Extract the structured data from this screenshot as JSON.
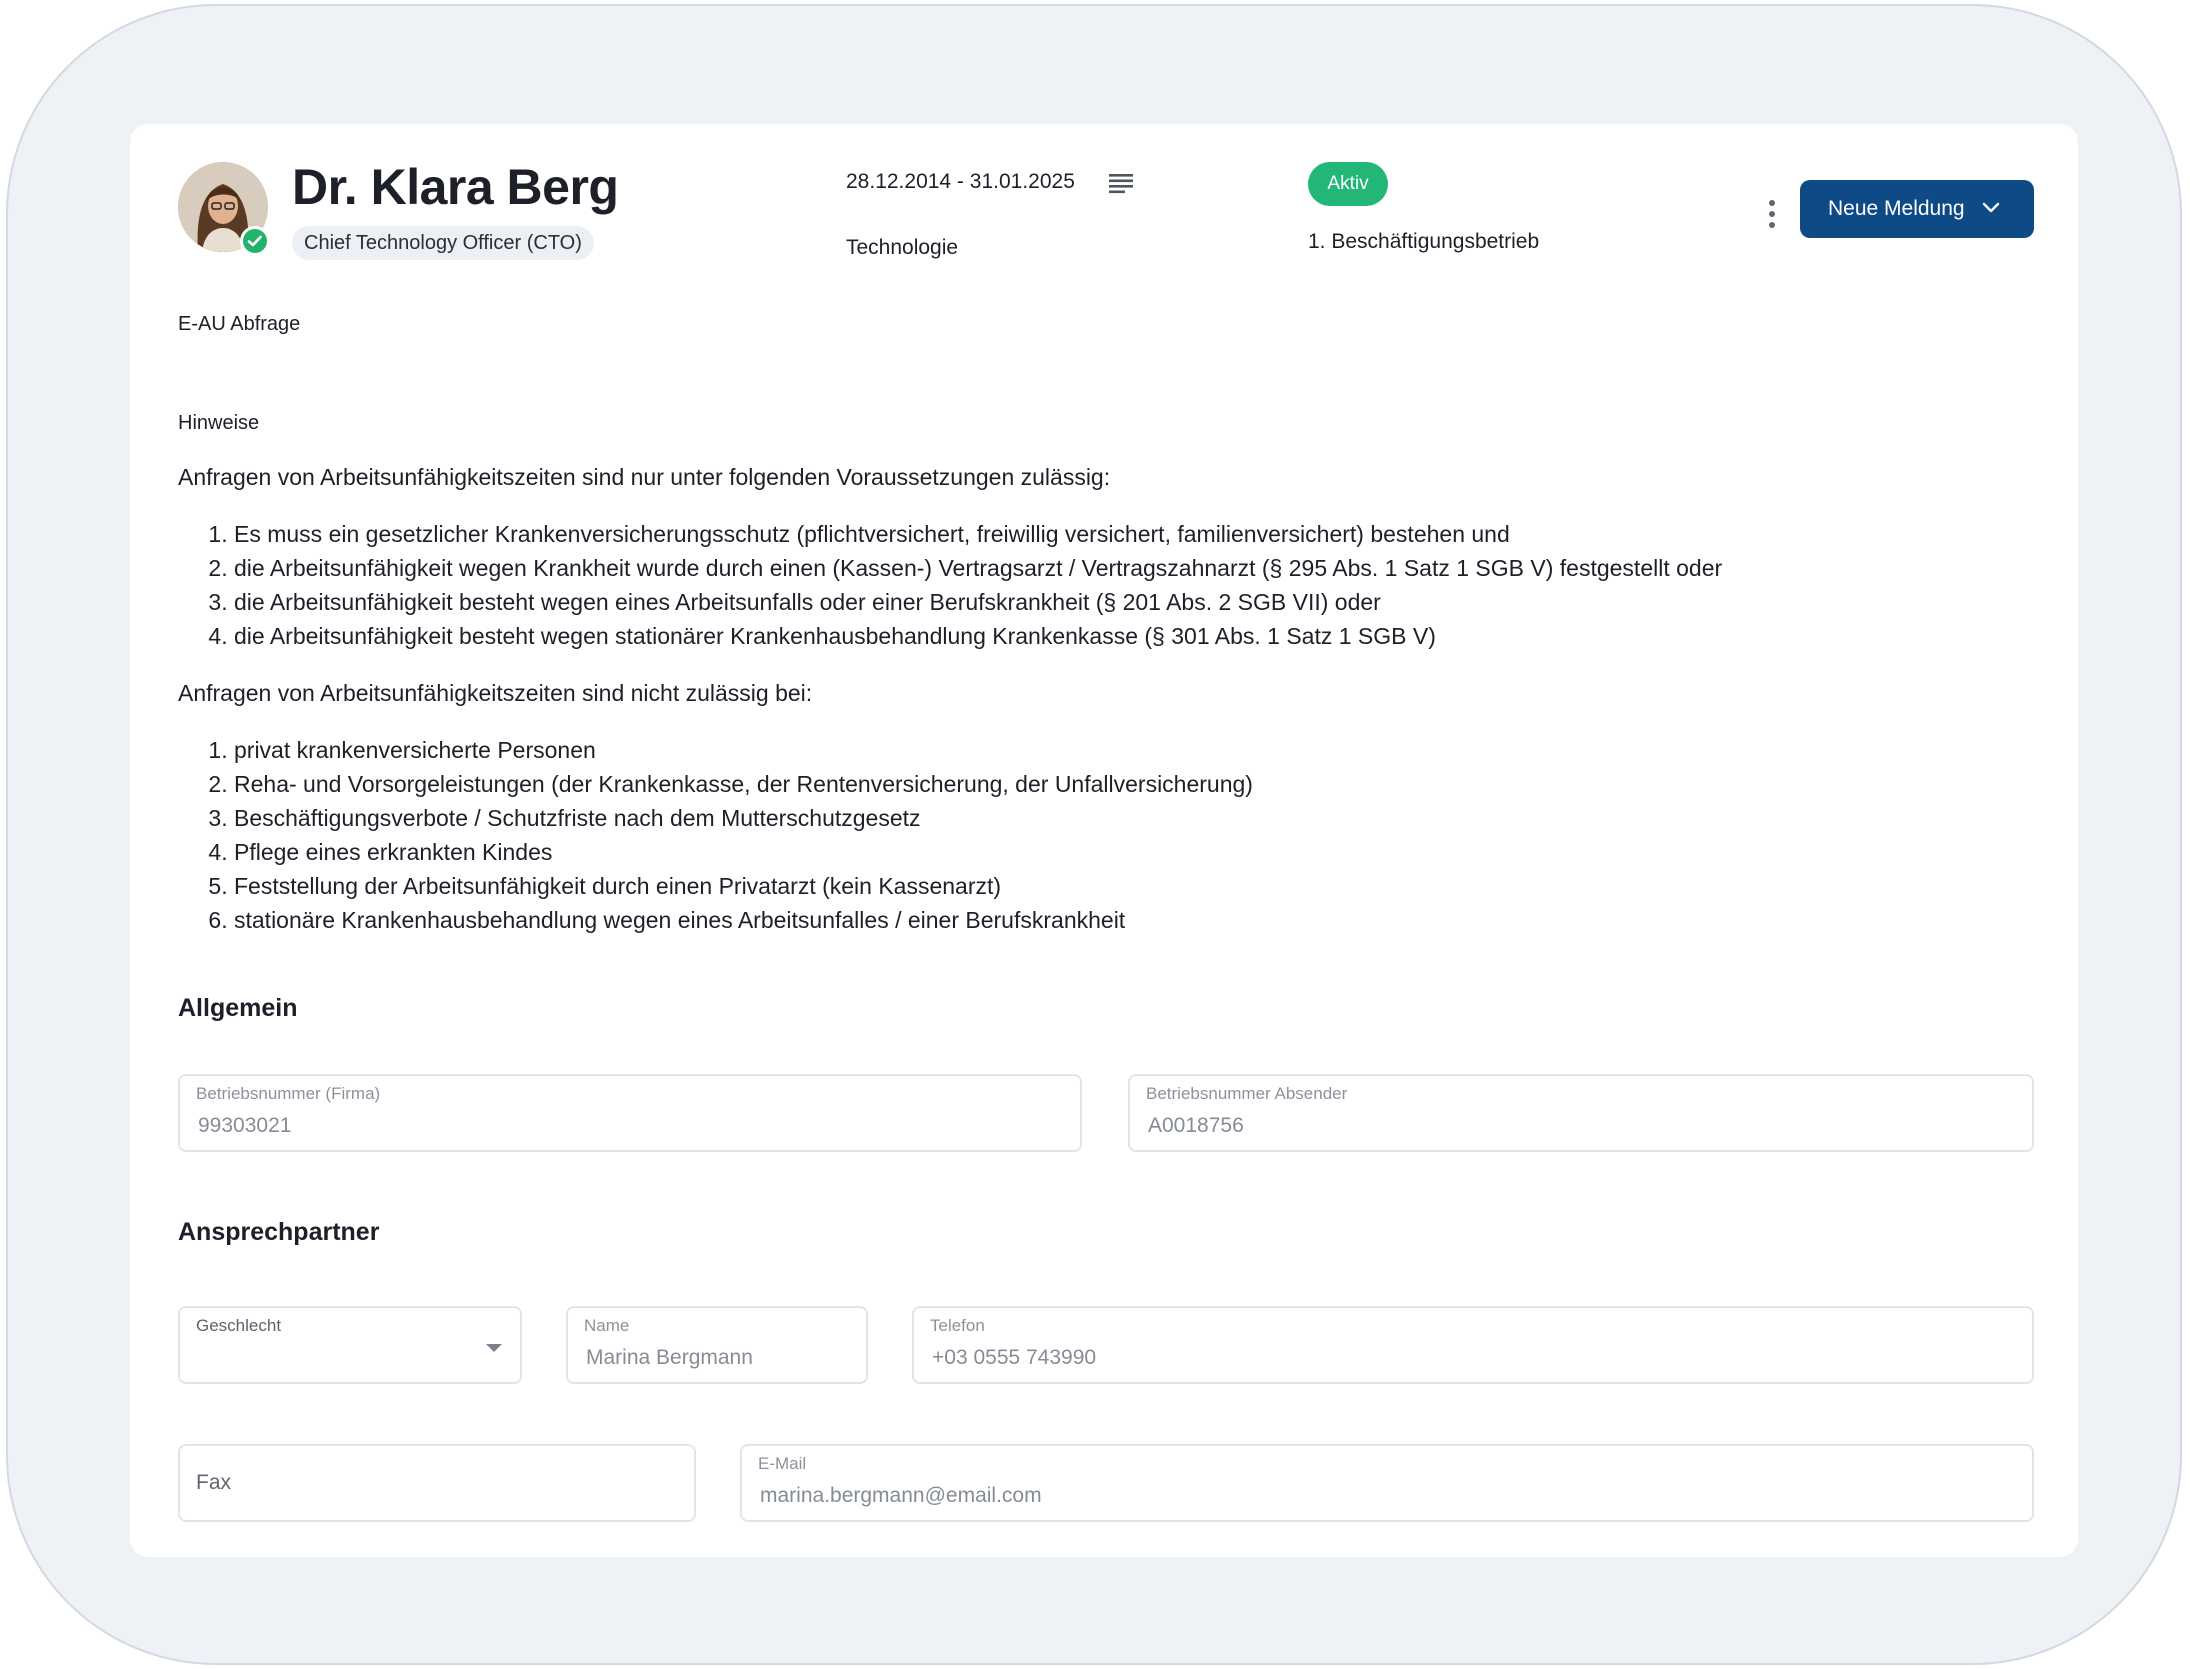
{
  "header": {
    "name": "Dr. Klara Berg",
    "role": "Chief Technology Officer (CTO)",
    "period": "28.12.2014 - 31.01.2025",
    "department": "Technologie",
    "status": "Aktiv",
    "employment": "1. Beschäftigungsbetrieb",
    "primary_button": "Neue Meldung",
    "colors": {
      "primary": "#0d4a86",
      "status": "#22b776",
      "verified": "#23b46c"
    }
  },
  "page_title": "E-AU Abfrage",
  "notes": {
    "title": "Hinweise",
    "allowed_intro": "Anfragen von Arbeitsunfähigkeitszeiten sind nur unter folgenden Voraussetzungen zulässig:",
    "allowed": [
      "Es muss ein gesetzlicher Krankenversicherungsschutz (pflichtversichert, freiwillig versichert, familienversichert) bestehen und",
      "die Arbeitsunfähigkeit wegen Krankheit wurde durch einen (Kassen-) Vertragsarzt / Vertragszahnarzt (§ 295 Abs. 1 Satz 1 SGB V) festgestellt oder",
      "die Arbeitsunfähigkeit besteht wegen eines Arbeitsunfalls oder einer Berufskrankheit (§ 201 Abs. 2 SGB VII) oder",
      "die Arbeitsunfähigkeit besteht wegen stationärer Krankenhausbehandlung Krankenkasse (§ 301 Abs. 1 Satz 1 SGB V)"
    ],
    "not_allowed_intro": "Anfragen von Arbeitsunfähigkeitszeiten sind nicht zulässig bei:",
    "not_allowed": [
      "privat krankenversicherte Personen",
      "Reha- und Vorsorgeleistungen (der Krankenkasse, der Rentenversicherung, der Unfallversicherung)",
      "Beschäftigungsverbote / Schutzfriste nach dem Mutterschutzgesetz",
      "Pflege eines erkrankten Kindes",
      "Feststellung der Arbeitsunfähigkeit durch einen Privatarzt (kein Kassenarzt)",
      "stationäre Krankenhausbehandlung wegen eines Arbeitsunfalles / einer Berufskrankheit"
    ]
  },
  "general": {
    "title": "Allgemein",
    "company_number_label": "Betriebsnummer (Firma)",
    "company_number": "99303021",
    "sender_number_label": "Betriebsnummer Absender",
    "sender_number": "A0018756"
  },
  "contact": {
    "title": "Ansprechpartner",
    "gender_label": "Geschlecht",
    "name_label": "Name",
    "name": "Marina Bergmann",
    "phone_label": "Telefon",
    "phone": "+03 0555 743990",
    "fax_placeholder": "Fax",
    "email_label": "E-Mail",
    "email": "marina.bergmann@email.com"
  }
}
